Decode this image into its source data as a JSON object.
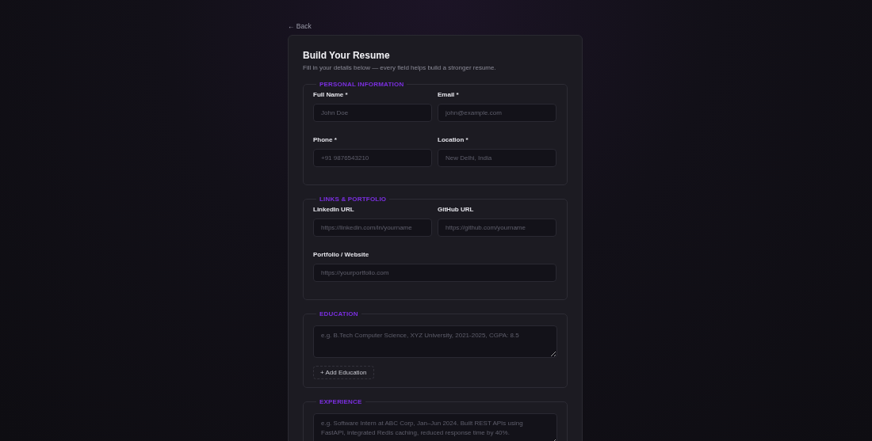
{
  "back_link": "← Back",
  "title": "Build Your Resume",
  "subtitle": "Fill in your details below — every field helps build a stronger resume.",
  "sections": [
    {
      "kind": "fields",
      "legend": "PERSONAL INFORMATION",
      "fields": [
        {
          "label": "Full Name *",
          "placeholder": "John Doe",
          "wide": false
        },
        {
          "label": "Email *",
          "placeholder": "john@example.com",
          "wide": false
        },
        {
          "label": "Phone *",
          "placeholder": "+91 9876543210",
          "wide": false
        },
        {
          "label": "Location *",
          "placeholder": "New Delhi, India",
          "wide": false
        }
      ]
    },
    {
      "kind": "fields",
      "legend": "LINKS & PORTFOLIO",
      "fields": [
        {
          "label": "LinkedIn URL",
          "placeholder": "https://linkedin.com/in/yourname",
          "wide": false
        },
        {
          "label": "GitHub URL",
          "placeholder": "https://github.com/yourname",
          "wide": false
        },
        {
          "label": "Portfolio / Website",
          "placeholder": "https://yourportfolio.com",
          "wide": true
        }
      ]
    },
    {
      "kind": "list",
      "legend": "EDUCATION",
      "placeholder": "e.g. B.Tech Computer Science, XYZ University, 2021-2025, CGPA: 8.5",
      "add_button": "+ Add Education"
    },
    {
      "kind": "list",
      "legend": "EXPERIENCE",
      "placeholder": "e.g. Software Intern at ABC Corp, Jan–Jun 2024. Built REST APIs using FastAPI, integrated Redis caching, reduced response time by 40%."
    }
  ]
}
